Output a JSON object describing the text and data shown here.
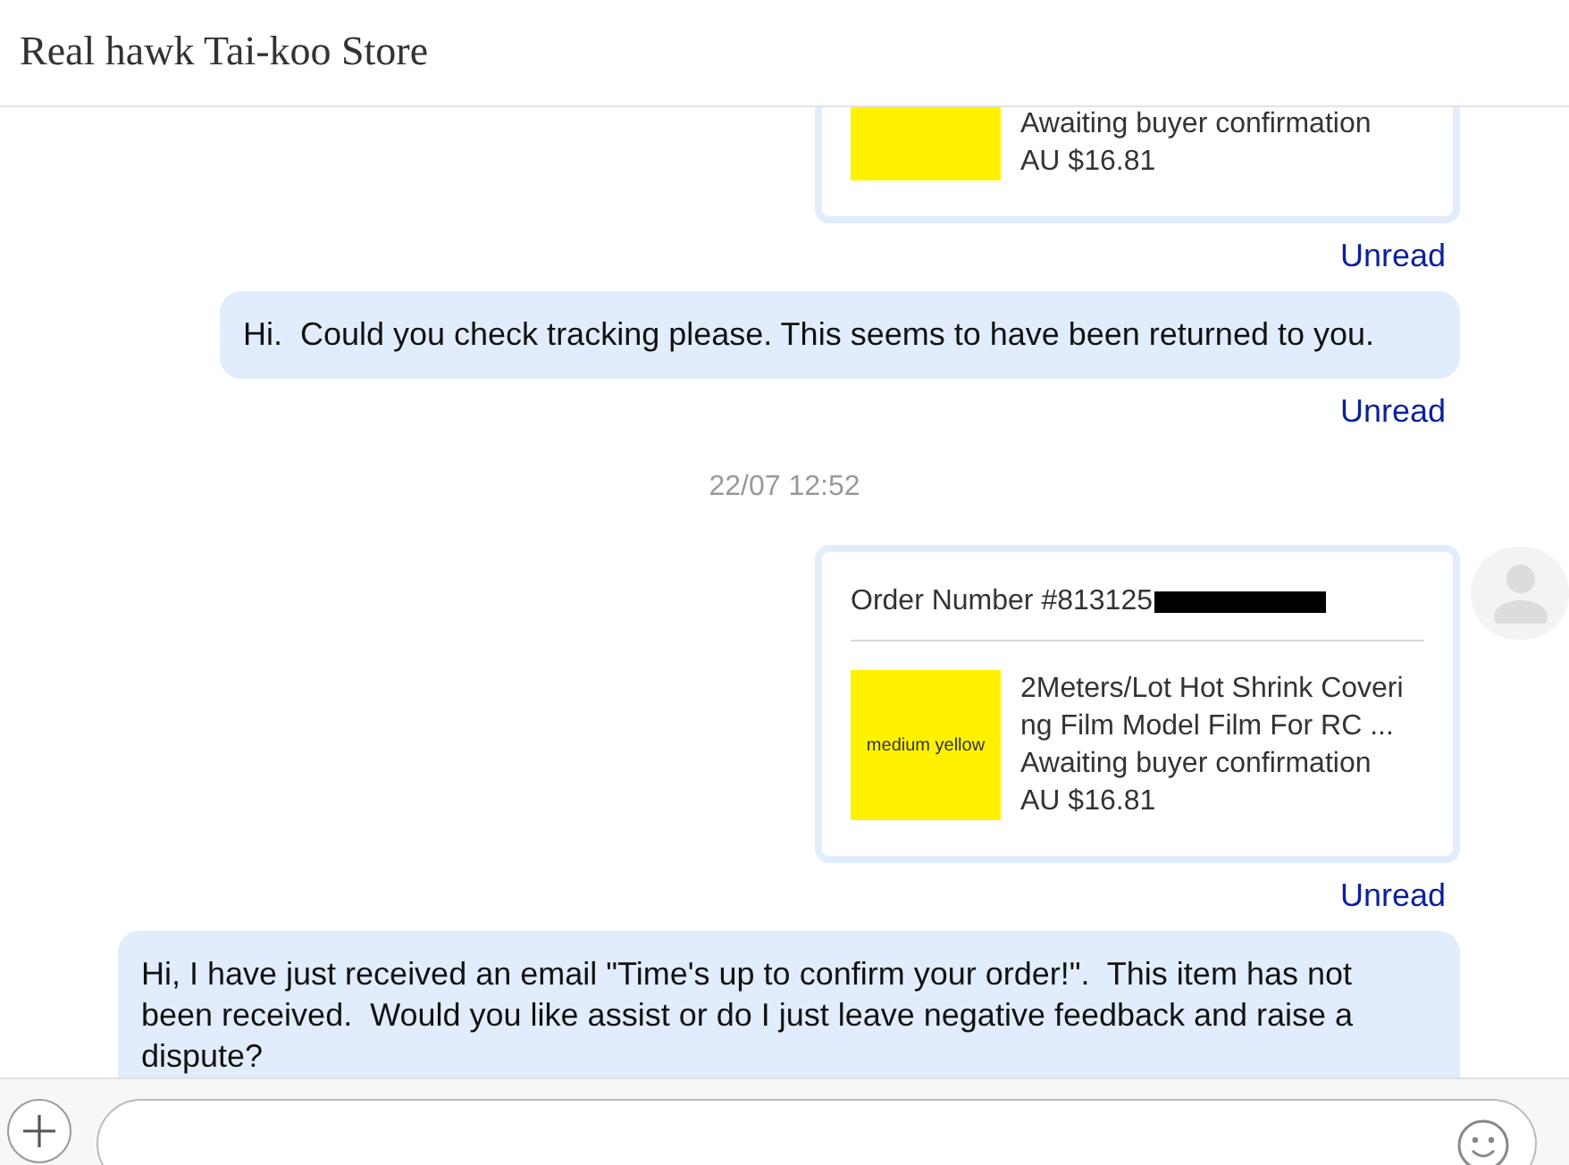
{
  "header": {
    "title": "Real hawk Tai-koo Store"
  },
  "messages": [
    {
      "kind": "order",
      "status": "Awaiting buyer confirmation",
      "price": "AU $16.81",
      "receipt": "Unread",
      "avatar": false
    },
    {
      "kind": "text",
      "text": "Hi.  Could you check tracking please. This seems to have been returned to you.",
      "receipt": "Unread"
    },
    {
      "kind": "time",
      "text": "22/07 12:52"
    },
    {
      "kind": "order",
      "order_number": "Order Number #813125",
      "redacted": true,
      "image_label": "medium yellow",
      "title": "2Meters/Lot Hot Shrink Covering Film Model Film For RC ...",
      "status": "Awaiting buyer confirmation",
      "price": "AU $16.81",
      "receipt": "Unread",
      "avatar": true
    },
    {
      "kind": "text",
      "text": "Hi, I have just received an email \"Time's up to confirm your order!\".  This item has not been received.  Would you like assist or do I just leave negative feedback and raise a dispute?"
    }
  ]
}
